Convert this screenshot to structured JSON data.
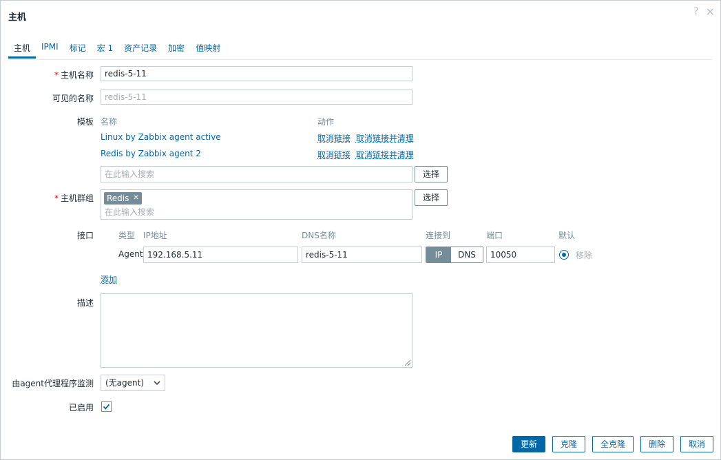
{
  "dialog": {
    "title": "主机",
    "help_icon": "?",
    "close_icon": "×"
  },
  "tabs": [
    {
      "label": "主机",
      "active": true
    },
    {
      "label": "IPMI"
    },
    {
      "label": "标记"
    },
    {
      "label": "宏 1"
    },
    {
      "label": "资产记录"
    },
    {
      "label": "加密"
    },
    {
      "label": "值映射"
    }
  ],
  "form": {
    "host_name": {
      "label": "主机名称",
      "value": "redis-5-11"
    },
    "visible_name": {
      "label": "可见的名称",
      "placeholder": "redis-5-11"
    },
    "templates": {
      "label": "模板",
      "col_name": "名称",
      "col_action": "动作",
      "items": [
        {
          "name": "Linux by Zabbix agent active",
          "unlink": "取消链接",
          "unlink_clear": "取消链接并清理"
        },
        {
          "name": "Redis by Zabbix agent 2",
          "unlink": "取消链接",
          "unlink_clear": "取消链接并清理"
        }
      ],
      "search_placeholder": "在此输入搜索",
      "select_label": "选择"
    },
    "host_groups": {
      "label": "主机群组",
      "tag": "Redis",
      "tag_remove": "✕",
      "search_placeholder": "在此输入搜索",
      "select_label": "选择"
    },
    "interfaces": {
      "label": "接口",
      "headers": {
        "type": "类型",
        "ip": "IP地址",
        "dns": "DNS名称",
        "connect": "连接到",
        "port": "端口",
        "default": "默认"
      },
      "row": {
        "type": "Agent",
        "ip": "192.168.5.11",
        "dns": "redis-5-11",
        "connect_ip": "IP",
        "connect_dns": "DNS",
        "port": "10050",
        "remove": "移除"
      },
      "add": "添加"
    },
    "description": {
      "label": "描述",
      "value": ""
    },
    "proxy": {
      "label": "由agent代理程序监测",
      "value": "(无agent)"
    },
    "enabled": {
      "label": "已启用",
      "checked": true
    }
  },
  "footer": {
    "update": "更新",
    "clone": "克隆",
    "full_clone": "全克隆",
    "delete": "删除",
    "cancel": "取消"
  },
  "colors": {
    "accent": "#0367a6",
    "required": "#d40000",
    "gray": "#768d99"
  }
}
